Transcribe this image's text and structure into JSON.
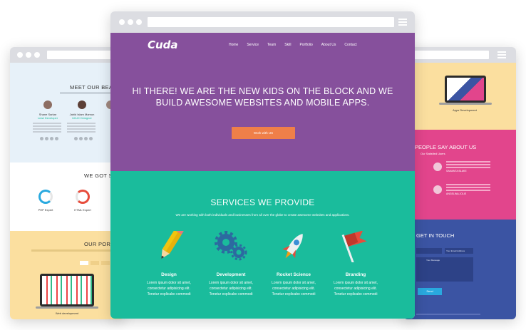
{
  "main_window": {
    "logo": "Cuda",
    "nav": [
      "Home",
      "Service",
      "Team",
      "Skill",
      "Portfolio",
      "About Us",
      "Contact"
    ],
    "hero_title": "HI THERE! WE ARE THE NEW KIDS ON THE BLOCK AND WE BUILD AWESOME WEBSITES AND MOBILE APPS.",
    "cta_label": "Work with US",
    "services_title": "SERVICES WE PROVIDE",
    "services_subtitle": "We are working with both individuals and businesses from all over the globe to create awesome websites and applications.",
    "services": [
      {
        "title": "Design",
        "line1": "Lorem ipsum dolor sit amet,",
        "line2": "consectetur adipisicing elit.",
        "line3": "Tenetur explicabo commodi",
        "icon": "pencil-icon"
      },
      {
        "title": "Development",
        "line1": "Lorem ipsum dolor sit amet,",
        "line2": "consectetur adipisicing elit.",
        "line3": "Tenetur explicabo commodi",
        "icon": "gears-icon"
      },
      {
        "title": "Rocket Science",
        "line1": "Lorem ipsum dolor sit amet,",
        "line2": "consectetur adipisicing elit.",
        "line3": "Tenetur explicabo commodi",
        "icon": "rocket-icon"
      },
      {
        "title": "Branding",
        "line1": "Lorem ipsum dolor sit amet,",
        "line2": "consectetur adipisicing elit.",
        "line3": "Tenetur explicabo commodi",
        "icon": "flag-icon"
      }
    ],
    "colors": {
      "hero": "#86509c",
      "services": "#1abc9c",
      "cta": "#ef7f49"
    }
  },
  "left_window": {
    "team_title": "MEET OUR BEAUTI",
    "members": [
      {
        "name": "Shane Sarkar",
        "role": "Lead Developer"
      },
      {
        "name": "Jahid Islam Mamun",
        "role": "UI/UX Designer"
      }
    ],
    "skills_title": "WE GOT SKI",
    "skills": [
      {
        "label": "PHP Expert",
        "color": "#29a9df"
      },
      {
        "label": "HTML Expert",
        "color": "#e74c3c"
      }
    ],
    "portfolio_title": "OUR PORTFO",
    "portfolio_caption": "Web development",
    "colors": {
      "team": "#e7f1f9",
      "skills": "#ffffff",
      "portfolio": "#fbdf9f"
    }
  },
  "right_window": {
    "top_caption": "Apps Development",
    "testimonial_title": "PEOPLE SAY ABOUT US",
    "testimonial_sub": "Our Satisfied Users",
    "testimonials": [
      {
        "author": "SAMANTA BLAKE"
      },
      {
        "author": "ANGELINA JOLIE"
      }
    ],
    "contact_title": "GET IN TOUCH",
    "contact_field_email": "Your Email Address",
    "contact_field_message": "Your Message",
    "contact_button": "Send",
    "colors": {
      "top": "#fbdf9f",
      "testimonials": "#e2458c",
      "contact": "#3b54a3"
    }
  }
}
